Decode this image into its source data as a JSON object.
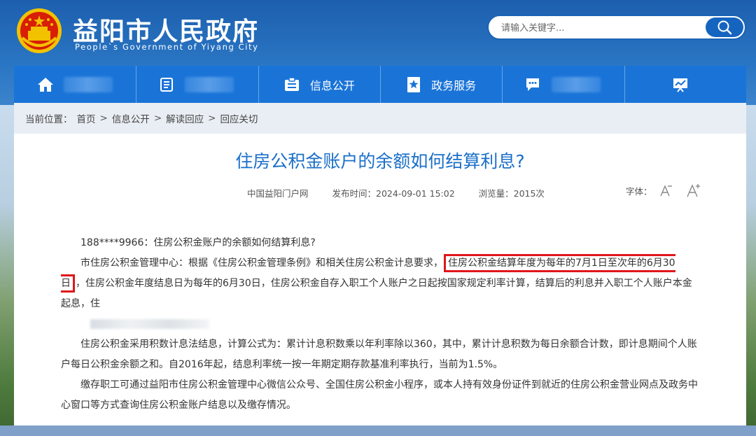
{
  "header": {
    "title": "益阳市人民政府",
    "subtitle": "People`s Government of Yiyang City",
    "search_placeholder": "请输入关键字..."
  },
  "nav": {
    "items": [
      {
        "label": "",
        "icon": "home-icon"
      },
      {
        "label": "",
        "icon": "document-list-icon"
      },
      {
        "label": "信息公开",
        "icon": "info-board-icon"
      },
      {
        "label": "政务服务",
        "icon": "star-bookmark-icon"
      },
      {
        "label": "",
        "icon": "chat-bubble-icon"
      },
      {
        "label": "",
        "icon": "presentation-chart-icon"
      }
    ]
  },
  "breadcrumb": {
    "prefix": "当前位置：",
    "items": [
      "首页",
      "信息公开",
      "解读回应",
      "回应关切"
    ],
    "separator": ">"
  },
  "article": {
    "title": "住房公积金账户的余额如何结算利息?",
    "source": "中国益阳门户网",
    "publish_time": "发布时间：2024-09-01 15:02",
    "views": "浏览量：2015次",
    "font_label": "字体：",
    "p1": "188****9966：住房公积金账户的余额如何结算利息?",
    "p2_a": "市住房公积金管理中心：根据《住房公积金管理条例》和相关住房公积金计息要求，",
    "p2_highlight": "住房公积金结算年度为每年的7月1日至次年的6月30日",
    "p2_b": "，住房公积金年度结息日为每年的6月30日，住房公积金自存入职工个人账户之日起按国家规定利率计算，结算后的利息并入职工个人账户本金起息，住",
    "p3": "住房公积金采用积数计息法结息，计算公式为：累计计息积数乘以年利率除以360，其中，累计计息积数为每日余额合计数，即计息期间个人账户每日公积金余额之和。自2016年起，结息利率统一按一年期定期存款基准利率执行，当前为1.5%。",
    "p4": "缴存职工可通过益阳市住房公积金管理中心微信公众号、全国住房公积金小程序，或本人持有效身份证件到就近的住房公积金营业网点及政务中心窗口等方式查询住房公积金账户结息以及缴存情况。"
  },
  "colors": {
    "nav_bg": "#1a74d8",
    "title_blue": "#1a6fc9",
    "highlight_red": "#e0161b"
  }
}
